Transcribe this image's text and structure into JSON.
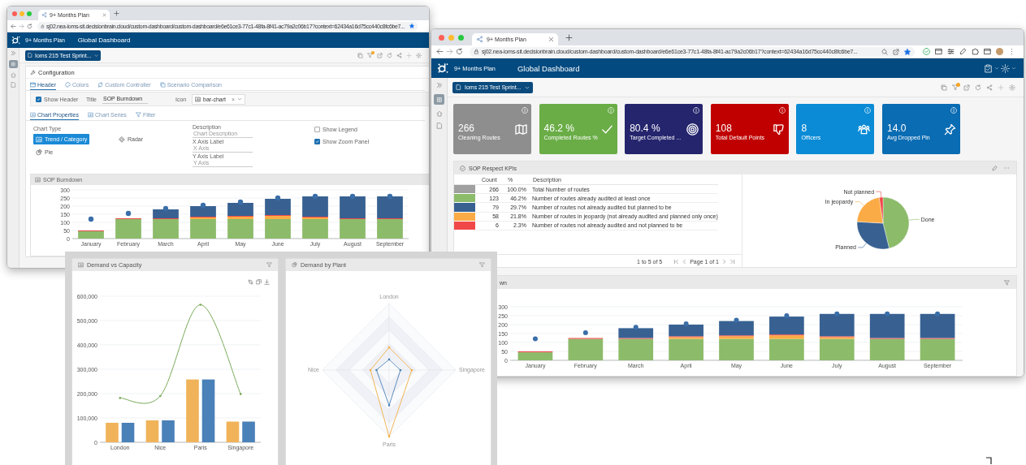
{
  "back_window": {
    "browser_tab": {
      "title": "9+ Months Plan"
    },
    "url": "sj02.nea-ioms-sit.decisionbrain.cloud/custom-dashboard/custom-dashboard/e6e61ce3-77c1-48fa-8f41-ac79a2c06b17?context=62434a16d75cc440c8fc6be7...",
    "app_header": {
      "app_name": "9+ Months Plan",
      "title": "Global Dashboard"
    },
    "scenario_button": "Ioms 215 Test Sprint...",
    "configuration": {
      "title": "Configuration",
      "tabs": [
        {
          "label": "Header",
          "selected": true
        },
        {
          "label": "Colors",
          "selected": false
        },
        {
          "label": "Custom Controller",
          "selected": false
        },
        {
          "label": "Scenario Comparison",
          "selected": false
        }
      ],
      "show_header": {
        "label": "Show Header",
        "checked": true
      },
      "title_field": {
        "label": "Title",
        "value": "SOP Burndown"
      },
      "icon_field": {
        "label": "Icon",
        "value": "bar-chart",
        "clear": "×"
      },
      "sub_tabs": [
        {
          "label": "Chart Properties",
          "selected": true
        },
        {
          "label": "Chart Series",
          "selected": false
        },
        {
          "label": "Filter",
          "selected": false
        }
      ],
      "chart_type": {
        "label": "Chart Type",
        "options": [
          {
            "label": "Trend / Category",
            "selected": true
          },
          {
            "label": "Radar",
            "selected": false
          },
          {
            "label": "Pie",
            "selected": false
          }
        ]
      },
      "fields": [
        {
          "label": "Description",
          "placeholder": "Chart Description"
        },
        {
          "label": "X Axis Label",
          "placeholder": "X Axis"
        },
        {
          "label": "Y Axis Label",
          "placeholder": "Y Axis"
        }
      ],
      "toggles": [
        {
          "label": "Show Legend",
          "checked": false
        },
        {
          "label": "Show Zoom Panel",
          "checked": true
        }
      ]
    },
    "preview": {
      "title": "SOP Burndown",
      "chart_data": {
        "type": "bar",
        "stacked": true,
        "grid": true,
        "categories": [
          "January",
          "February",
          "March",
          "April",
          "May",
          "June",
          "July",
          "August",
          "September"
        ],
        "ylim": [
          0,
          300
        ],
        "yticks": [
          0,
          50,
          100,
          150,
          200,
          250,
          300
        ],
        "series": [
          {
            "type": "bar",
            "color": "#8cbb6a",
            "values": [
              45,
              120,
              120,
              120,
              120,
              120,
              120,
              120,
              120
            ]
          },
          {
            "type": "bar",
            "color": "#fbab45",
            "values": [
              0,
              0,
              0,
              10,
              15,
              20,
              10,
              0,
              0
            ]
          },
          {
            "type": "bar",
            "color": "#ef4b4b",
            "values": [
              5,
              5,
              5,
              5,
              5,
              5,
              5,
              5,
              5
            ]
          },
          {
            "type": "bar",
            "color": "#386192",
            "values": [
              0,
              0,
              55,
              65,
              80,
              100,
              125,
              135,
              135
            ]
          },
          {
            "type": "scatter",
            "color": "#3a6ea8",
            "values": [
              120,
              155,
              185,
              205,
              225,
              250,
              260,
              260,
              260
            ]
          }
        ]
      }
    }
  },
  "front_window": {
    "browser_tab": {
      "title": "9+ Months Plan"
    },
    "url": "sj02.nea-ioms-sit.decisionbrain.cloud/custom-dashboard/custom-dashboard/e6e61ce3-77c1-48fa-8f41-ac79a2c06b17?context=62434a16d75cc440c8fc6be7...",
    "app_header": {
      "app_name": "9+ Months Plan",
      "title": "Global Dashboard"
    },
    "scenario_button": "Ioms 215 Test Sprint...",
    "kpi_cards": [
      {
        "value": "266",
        "label": "Cleaning Routes",
        "color": "#8e8e8e",
        "kind": "map"
      },
      {
        "value": "46.2 %",
        "label": "Completed Routes %",
        "color": "#6aad47",
        "kind": "check"
      },
      {
        "value": "80.4 %",
        "label": "Target Completed ...",
        "color": "#25256e",
        "kind": "target"
      },
      {
        "value": "108",
        "label": "Total Default Points",
        "color": "#c00000",
        "kind": "thumbs-down"
      },
      {
        "value": "8",
        "label": "Officers",
        "color": "#0b8bd6",
        "kind": "people"
      },
      {
        "value": "14.0",
        "label": "Avg Dropped Pin",
        "color": "#0a6cb3",
        "kind": "pin"
      }
    ],
    "kpi_panel": {
      "title": "SOP Respect KPIs",
      "columns": [
        "Count",
        "%",
        "Description"
      ],
      "rows": [
        {
          "color": "#a0a0a0",
          "count": "266",
          "percent": "100.0%",
          "description": "Total Number of routes"
        },
        {
          "color": "#8cbb6a",
          "count": "123",
          "percent": "46.2%",
          "description": "Number of routes already audited at least once"
        },
        {
          "color": "#386192",
          "count": "79",
          "percent": "29.7%",
          "description": "Number of routes not already audited but planned to be"
        },
        {
          "color": "#fbab45",
          "count": "58",
          "percent": "21.8%",
          "description": "Number of routes in jeopardy (not already audited and planned only once)"
        },
        {
          "color": "#f04848",
          "count": "6",
          "percent": "2.3%",
          "description": "Number of routes not already audited and not planned to be"
        }
      ],
      "pagination": {
        "range": "1 to 5 of 5",
        "page": "Page 1 of 1"
      },
      "pie": {
        "chart_data": {
          "type": "pie",
          "categories": [
            "Done",
            "Planned",
            "In jeopardy",
            "Not planned"
          ],
          "values": [
            46.2,
            29.7,
            21.8,
            2.3
          ],
          "colors": [
            "#8cbb6a",
            "#386192",
            "#fbab45",
            "#f04848"
          ]
        }
      }
    },
    "burndown": {
      "title": "wn",
      "chart_data": {
        "type": "bar",
        "stacked": true,
        "grid": true,
        "categories": [
          "January",
          "February",
          "March",
          "April",
          "May",
          "June",
          "July",
          "August",
          "September"
        ],
        "ylim": [
          0,
          300
        ],
        "yticks": [
          0,
          50,
          100,
          150,
          200,
          250,
          300
        ],
        "series": [
          {
            "type": "bar",
            "color": "#8cbb6a",
            "values": [
              45,
              120,
              120,
              120,
              120,
              120,
              120,
              120,
              120
            ]
          },
          {
            "type": "bar",
            "color": "#fbab45",
            "values": [
              0,
              0,
              0,
              10,
              15,
              20,
              10,
              0,
              0
            ]
          },
          {
            "type": "bar",
            "color": "#ef4b4b",
            "values": [
              5,
              5,
              5,
              5,
              5,
              5,
              5,
              5,
              5
            ]
          },
          {
            "type": "bar",
            "color": "#386192",
            "values": [
              0,
              0,
              55,
              65,
              80,
              100,
              125,
              135,
              135
            ]
          },
          {
            "type": "scatter",
            "color": "#3a6ea8",
            "values": [
              120,
              155,
              185,
              205,
              225,
              250,
              260,
              260,
              260
            ]
          }
        ]
      }
    }
  },
  "demand_panels": {
    "capacity": {
      "title": "Demand vs Capacity",
      "chart_data": {
        "type": "bar",
        "stacked": false,
        "grid": true,
        "categories": [
          "London",
          "Nice",
          "Paris",
          "Singapore"
        ],
        "ylim": [
          0,
          600000
        ],
        "yticks": [
          {
            "value": 0,
            "label": "0"
          },
          {
            "value": 100000,
            "label": "100,000"
          },
          {
            "value": 200000,
            "label": "200,000"
          },
          {
            "value": 300000,
            "label": "300,000"
          },
          {
            "value": 400000,
            "label": "400,000"
          },
          {
            "value": 500000,
            "label": "500,000"
          },
          {
            "value": 600000,
            "label": "600,000"
          }
        ],
        "series": [
          {
            "type": "bar",
            "color": "#f0b35a",
            "values": [
              80000,
              90000,
              258000,
              85000
            ]
          },
          {
            "type": "bar",
            "color": "#4a81b8",
            "values": [
              80000,
              90000,
              258000,
              85000
            ]
          },
          {
            "type": "line",
            "color": "#79aa58",
            "values": [
              182000,
              190000,
              565000,
              198000
            ]
          }
        ]
      }
    },
    "plant": {
      "title": "Demand by Plant",
      "axis_labels": [
        "London",
        "Singapore",
        "Paris",
        "Nice"
      ]
    }
  }
}
